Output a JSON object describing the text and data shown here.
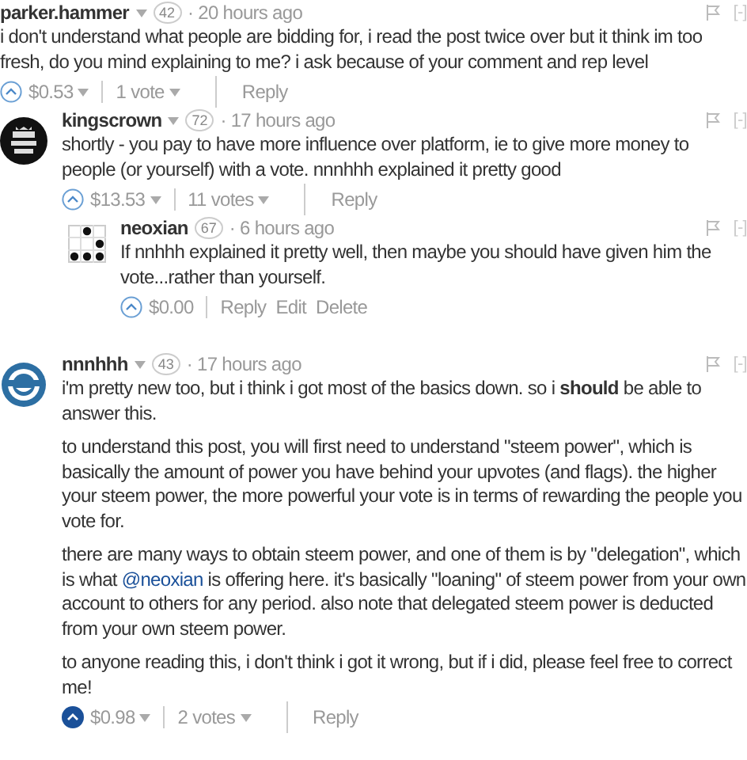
{
  "comments": [
    {
      "author": "parker.hammer",
      "menu": true,
      "rep": "42",
      "time": "· 20 hours ago",
      "flag": true,
      "collapse": "[-]",
      "paragraphs": [
        [
          {
            "kind": "text",
            "text": "i don't understand what people are bidding for, i read the post twice over but it think im too fresh, do you mind explaining to me? i ask because of your comment and rep level"
          }
        ]
      ],
      "upvoted": false,
      "payout": "$0.53",
      "votes": "1 vote",
      "actions": [
        "Reply"
      ],
      "children": [
        {
          "author": "kingscrown",
          "avatar": {
            "kind": "emblem"
          },
          "menu": true,
          "rep": "72",
          "time": "· 17 hours ago",
          "flag": true,
          "collapse": "[-]",
          "paragraphs": [
            [
              {
                "kind": "text",
                "text": "shortly - you pay to have more influence over platform, ie to give more money to people (or yourself) with a vote. nnnhhh explained it pretty good"
              }
            ]
          ],
          "upvoted": false,
          "payout": "$13.53",
          "votes": "11 votes",
          "actions": [
            "Reply"
          ],
          "children": [
            {
              "author": "neoxian",
              "avatar": {
                "kind": "dots"
              },
              "menu": false,
              "rep": "67",
              "time": "· 6 hours ago",
              "flag": true,
              "collapse": "[-]",
              "paragraphs": [
                [
                  {
                    "kind": "text",
                    "text": "If nnhhh explained it pretty well, then maybe you should have given him the vote...rather than yourself."
                  }
                ]
              ],
              "upvoted": false,
              "payout": "$0.00",
              "actions": [
                "Reply",
                "Edit",
                "Delete"
              ]
            }
          ]
        },
        {
          "author": "nnnhhh",
          "avatar": {
            "kind": "ring"
          },
          "menu": true,
          "rep": "43",
          "time": "· 17 hours ago",
          "flag": true,
          "collapse": "[-]",
          "paragraphs": [
            [
              {
                "kind": "text",
                "text": "i'm pretty new too, but i think i got most of the basics down. so i **should** be able to answer this."
              }
            ],
            [
              {
                "kind": "text",
                "text": "to understand this post, you will first need to understand \"steem power\", which is basically the amount of power you have behind your upvotes (and flags). the higher your steem power, the more powerful your vote is in terms of rewarding the people you vote for."
              }
            ],
            [
              {
                "kind": "text",
                "text": "there are many ways to obtain steem power, and one of them is by \"delegation\", which is what "
              },
              {
                "kind": "link",
                "text": "@neoxian"
              },
              {
                "kind": "text",
                "text": " is offering here. it's basically \"loaning\" of steem power from your own account to others for any period. also note that delegated steem power is deducted from your own steem power."
              }
            ],
            [
              {
                "kind": "text",
                "text": "to anyone reading this, i don't think i got it wrong, but if i did, please feel free to correct me!"
              }
            ]
          ],
          "upvoted": true,
          "payout": "$0.98",
          "votes": "2 votes",
          "actions": [
            "Reply"
          ]
        }
      ]
    }
  ]
}
